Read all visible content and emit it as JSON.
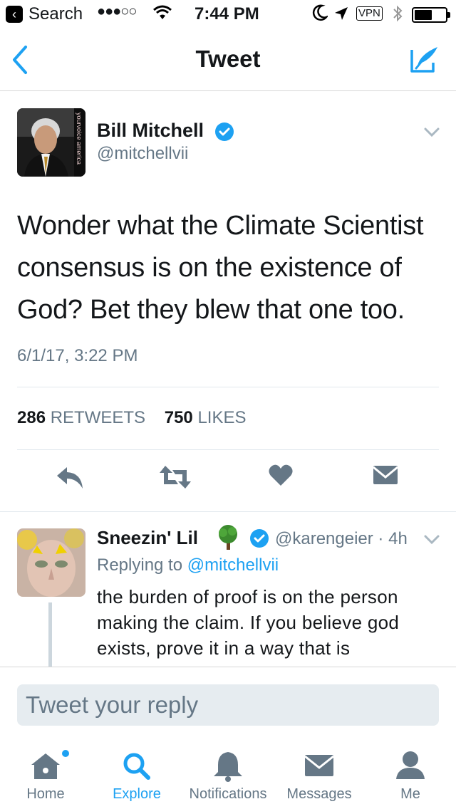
{
  "status_bar": {
    "back_app": "Search",
    "signal": "●●●○○",
    "time": "7:44 PM",
    "vpn": "VPN"
  },
  "nav": {
    "title": "Tweet"
  },
  "tweet": {
    "author_name": "Bill Mitchell",
    "handle": "@mitchellvii",
    "avatar_caption": "yourvoice america",
    "text": "Wonder what the Climate Scientist consensus is on the existence of God?  Bet they blew that one too.",
    "date": "6/1/17, 3:22 PM",
    "retweets_count": "286",
    "retweets_label": "RETWEETS",
    "likes_count": "750",
    "likes_label": "LIKES"
  },
  "reply": {
    "author_name": "Sneezin'  Lil",
    "handle_time": "@karengeier · 4h",
    "replying_prefix": "Replying to",
    "replying_to": "@mitchellvii",
    "text": "the burden of proof is on the person making the claim. If you believe god exists, prove it in a way that is"
  },
  "composer": {
    "placeholder": "Tweet your reply"
  },
  "tabs": [
    {
      "label": "Home",
      "icon": "home-icon",
      "active": false
    },
    {
      "label": "Explore",
      "icon": "search-icon",
      "active": true
    },
    {
      "label": "Notifications",
      "icon": "bell-icon",
      "active": false
    },
    {
      "label": "Messages",
      "icon": "envelope-icon",
      "active": false
    },
    {
      "label": "Me",
      "icon": "person-icon",
      "active": false
    }
  ],
  "colors": {
    "accent": "#1da1f2",
    "secondary_text": "#657786",
    "primary_text": "#14171a",
    "divider": "#e1e8ed"
  }
}
